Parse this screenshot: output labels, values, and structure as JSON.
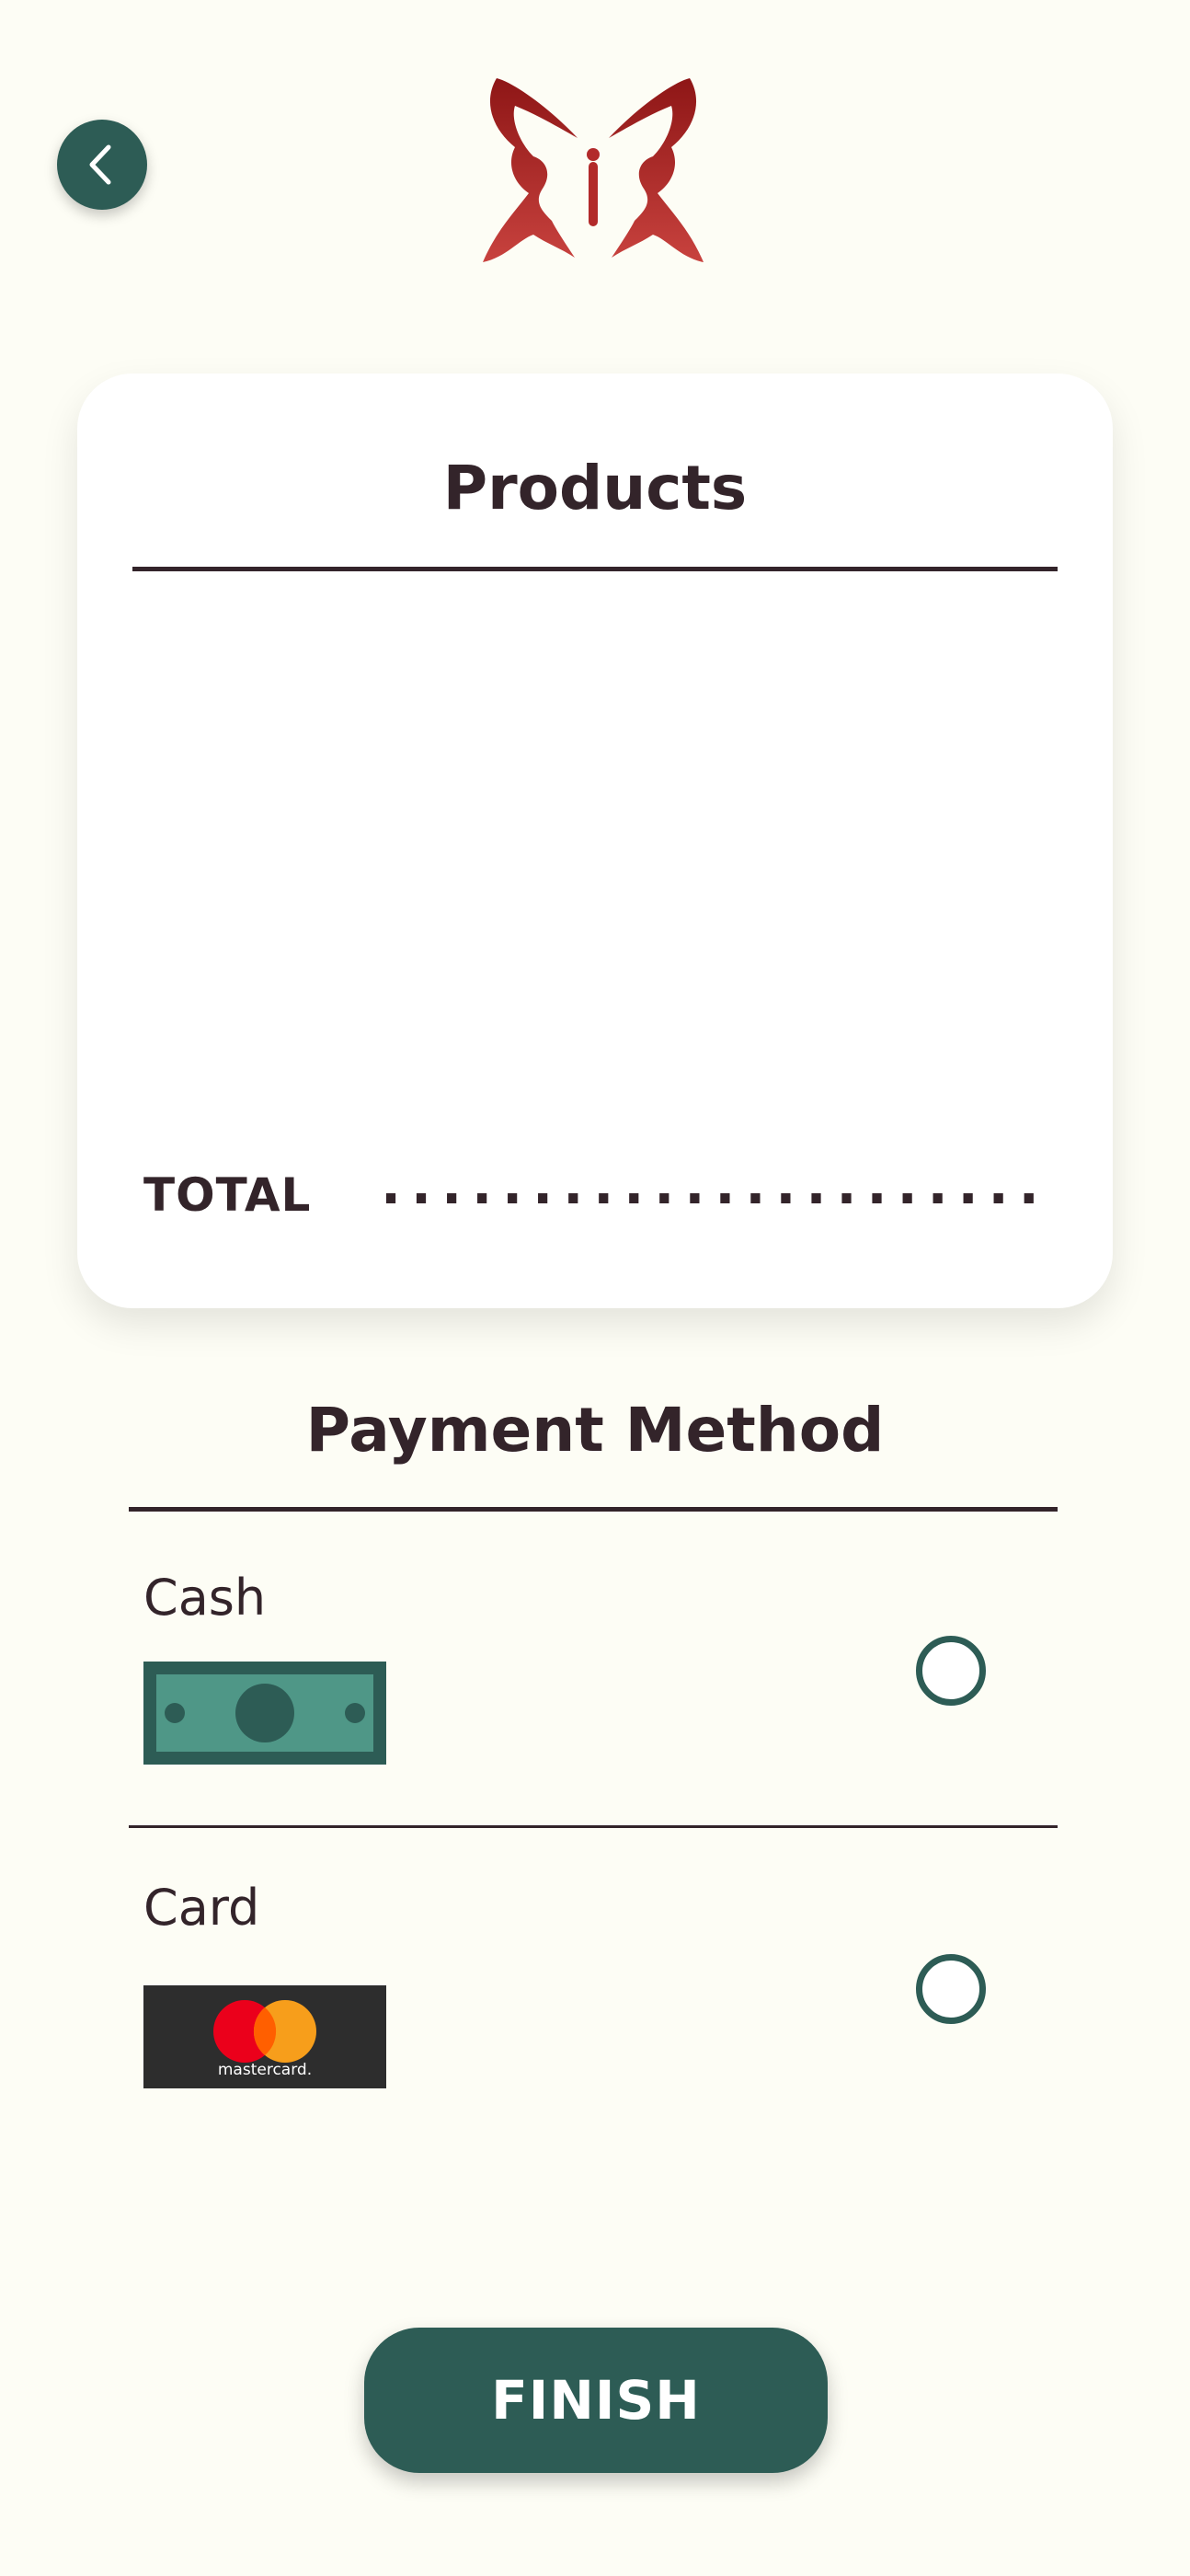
{
  "header": {
    "back_icon": "chevron-left-icon",
    "logo_icon": "butterfly-logo"
  },
  "order": {
    "products_title": "Products",
    "total_label": "TOTAL",
    "total_value": "......................"
  },
  "payment": {
    "title": "Payment Method",
    "options": [
      {
        "label": "Cash",
        "icon": "cash-bill-icon",
        "selected": false
      },
      {
        "label": "Card",
        "icon": "mastercard-logo",
        "selected": false,
        "brand_text": "mastercard."
      }
    ]
  },
  "footer": {
    "finish_label": "FINISH"
  },
  "colors": {
    "background": "#fdfdf5",
    "primary": "#2d5c55",
    "text": "#33242a",
    "logo": "#b22a2a"
  }
}
